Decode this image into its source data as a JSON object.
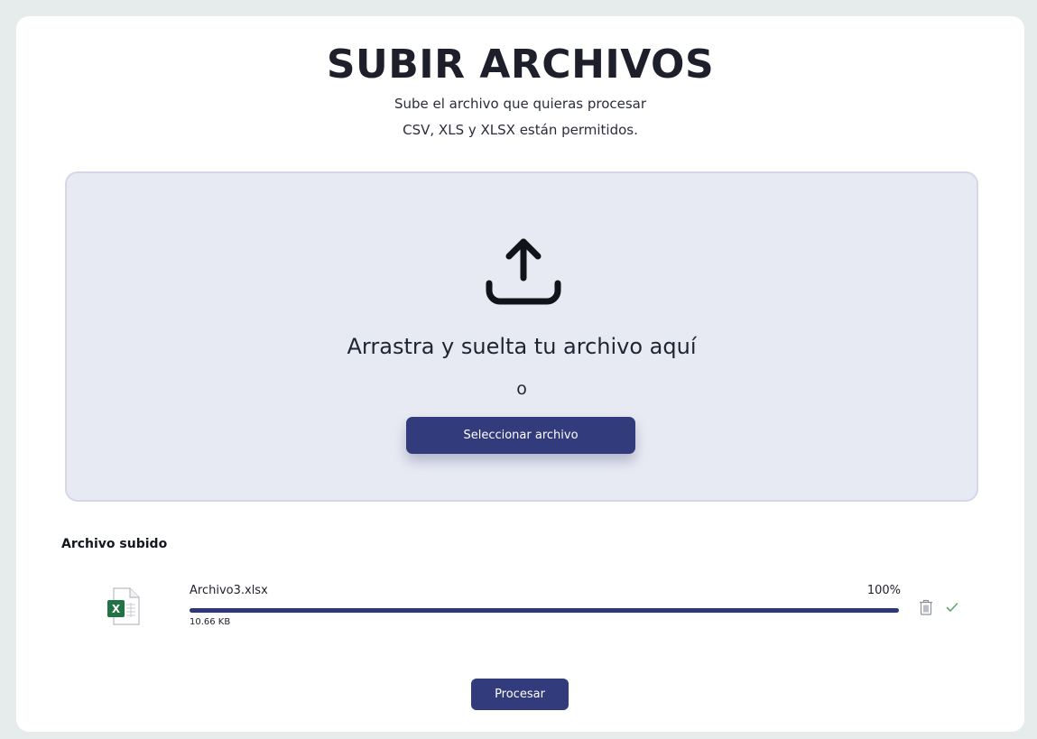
{
  "header": {
    "title": "SUBIR ARCHIVOS",
    "subtitle_line1": "Sube el archivo que quieras procesar",
    "subtitle_line2": "CSV, XLS y XLSX están permitidos."
  },
  "dropzone": {
    "icon": "upload-icon",
    "drag_text": "Arrastra y suelta tu archivo aquí",
    "or_text": "o",
    "select_button_label": "Seleccionar archivo"
  },
  "uploaded": {
    "section_label": "Archivo subido",
    "files": [
      {
        "name": "Archivo3.xlsx",
        "size": "10.66 KB",
        "percent_text": "100%",
        "progress": 1.0,
        "file_icon": "excel-file-icon",
        "icon_color": "#217346",
        "status_icon": "check-icon",
        "status_color": "#5aa86a"
      }
    ]
  },
  "actions": {
    "process_label": "Procesar"
  },
  "colors": {
    "accent": "#323b7b",
    "background": "#e6ebec",
    "dropzone_bg": "#e8eaf3"
  }
}
